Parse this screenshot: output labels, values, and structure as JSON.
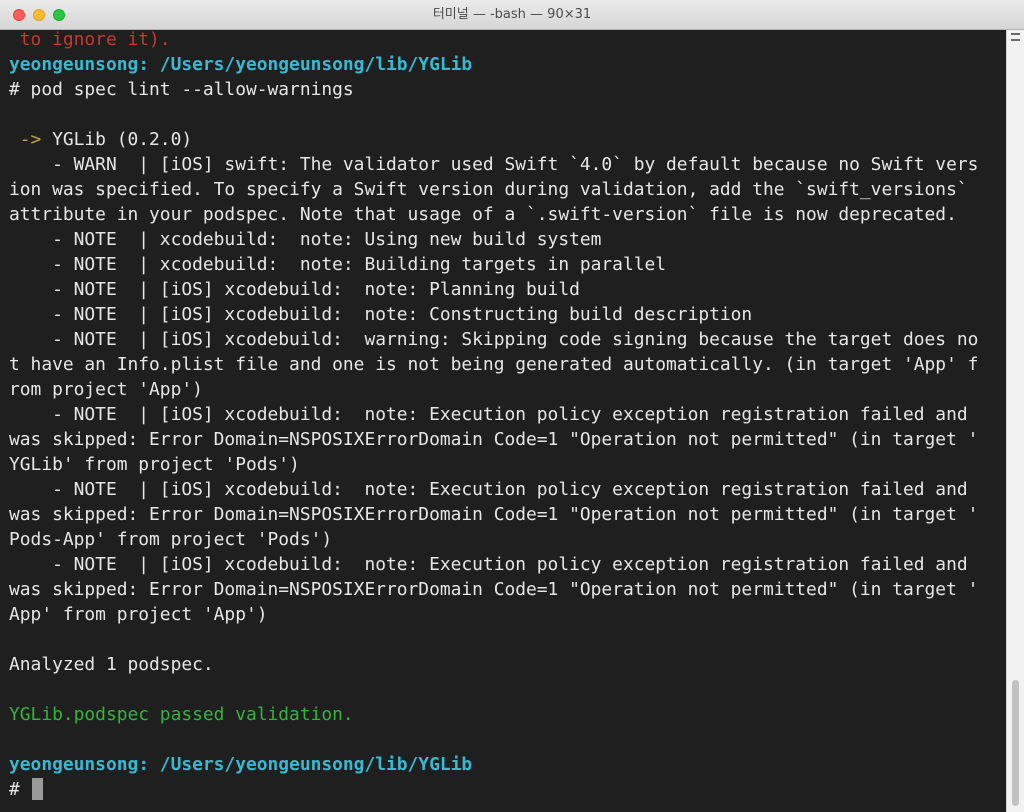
{
  "window": {
    "title": "터미널 — -bash — 90×31"
  },
  "colors": {
    "background": "#1f1f1f",
    "prompt": "#3ab8cf",
    "warning_red": "#c7392d",
    "arrow_yellow": "#c9a23a",
    "success_green": "#32b53a",
    "text": "#e6e6e6"
  },
  "terminal": {
    "lines": [
      [
        {
          "t": " to ignore it).",
          "c": "red"
        }
      ],
      [
        {
          "t": "yeongeunsong: /Users/yeongeunsong/lib/YGLib",
          "c": "prompt"
        }
      ],
      [
        {
          "t": "# pod spec lint --allow-warnings",
          "c": "text"
        }
      ],
      [
        {
          "t": "",
          "c": "text"
        }
      ],
      [
        {
          "t": " -> ",
          "c": "arrow"
        },
        {
          "t": "YGLib (0.2.0)",
          "c": "text"
        }
      ],
      [
        {
          "t": "    - WARN  | [iOS] swift: The validator used Swift `4.0` by default because no Swift vers",
          "c": "text"
        }
      ],
      [
        {
          "t": "ion was specified. To specify a Swift version during validation, add the `swift_versions`",
          "c": "text"
        }
      ],
      [
        {
          "t": "attribute in your podspec. Note that usage of a `.swift-version` file is now deprecated.",
          "c": "text"
        }
      ],
      [
        {
          "t": "    - NOTE  | xcodebuild:  note: Using new build system",
          "c": "text"
        }
      ],
      [
        {
          "t": "    - NOTE  | xcodebuild:  note: Building targets in parallel",
          "c": "text"
        }
      ],
      [
        {
          "t": "    - NOTE  | [iOS] xcodebuild:  note: Planning build",
          "c": "text"
        }
      ],
      [
        {
          "t": "    - NOTE  | [iOS] xcodebuild:  note: Constructing build description",
          "c": "text"
        }
      ],
      [
        {
          "t": "    - NOTE  | [iOS] xcodebuild:  warning: Skipping code signing because the target does no",
          "c": "text"
        }
      ],
      [
        {
          "t": "t have an Info.plist file and one is not being generated automatically. (in target 'App' f",
          "c": "text"
        }
      ],
      [
        {
          "t": "rom project 'App')",
          "c": "text"
        }
      ],
      [
        {
          "t": "    - NOTE  | [iOS] xcodebuild:  note: Execution policy exception registration failed and",
          "c": "text"
        }
      ],
      [
        {
          "t": "was skipped: Error Domain=NSPOSIXErrorDomain Code=1 \"Operation not permitted\" (in target '",
          "c": "text"
        }
      ],
      [
        {
          "t": "YGLib' from project 'Pods')",
          "c": "text"
        }
      ],
      [
        {
          "t": "    - NOTE  | [iOS] xcodebuild:  note: Execution policy exception registration failed and",
          "c": "text"
        }
      ],
      [
        {
          "t": "was skipped: Error Domain=NSPOSIXErrorDomain Code=1 \"Operation not permitted\" (in target '",
          "c": "text"
        }
      ],
      [
        {
          "t": "Pods-App' from project 'Pods')",
          "c": "text"
        }
      ],
      [
        {
          "t": "    - NOTE  | [iOS] xcodebuild:  note: Execution policy exception registration failed and",
          "c": "text"
        }
      ],
      [
        {
          "t": "was skipped: Error Domain=NSPOSIXErrorDomain Code=1 \"Operation not permitted\" (in target '",
          "c": "text"
        }
      ],
      [
        {
          "t": "App' from project 'App')",
          "c": "text"
        }
      ],
      [
        {
          "t": "",
          "c": "text"
        }
      ],
      [
        {
          "t": "Analyzed 1 podspec.",
          "c": "text"
        }
      ],
      [
        {
          "t": "",
          "c": "text"
        }
      ],
      [
        {
          "t": "YGLib.podspec passed validation.",
          "c": "green"
        }
      ],
      [
        {
          "t": "",
          "c": "text"
        }
      ],
      [
        {
          "t": "yeongeunsong: /Users/yeongeunsong/lib/YGLib",
          "c": "prompt"
        }
      ]
    ],
    "input_prompt": "#",
    "input_value": ""
  }
}
